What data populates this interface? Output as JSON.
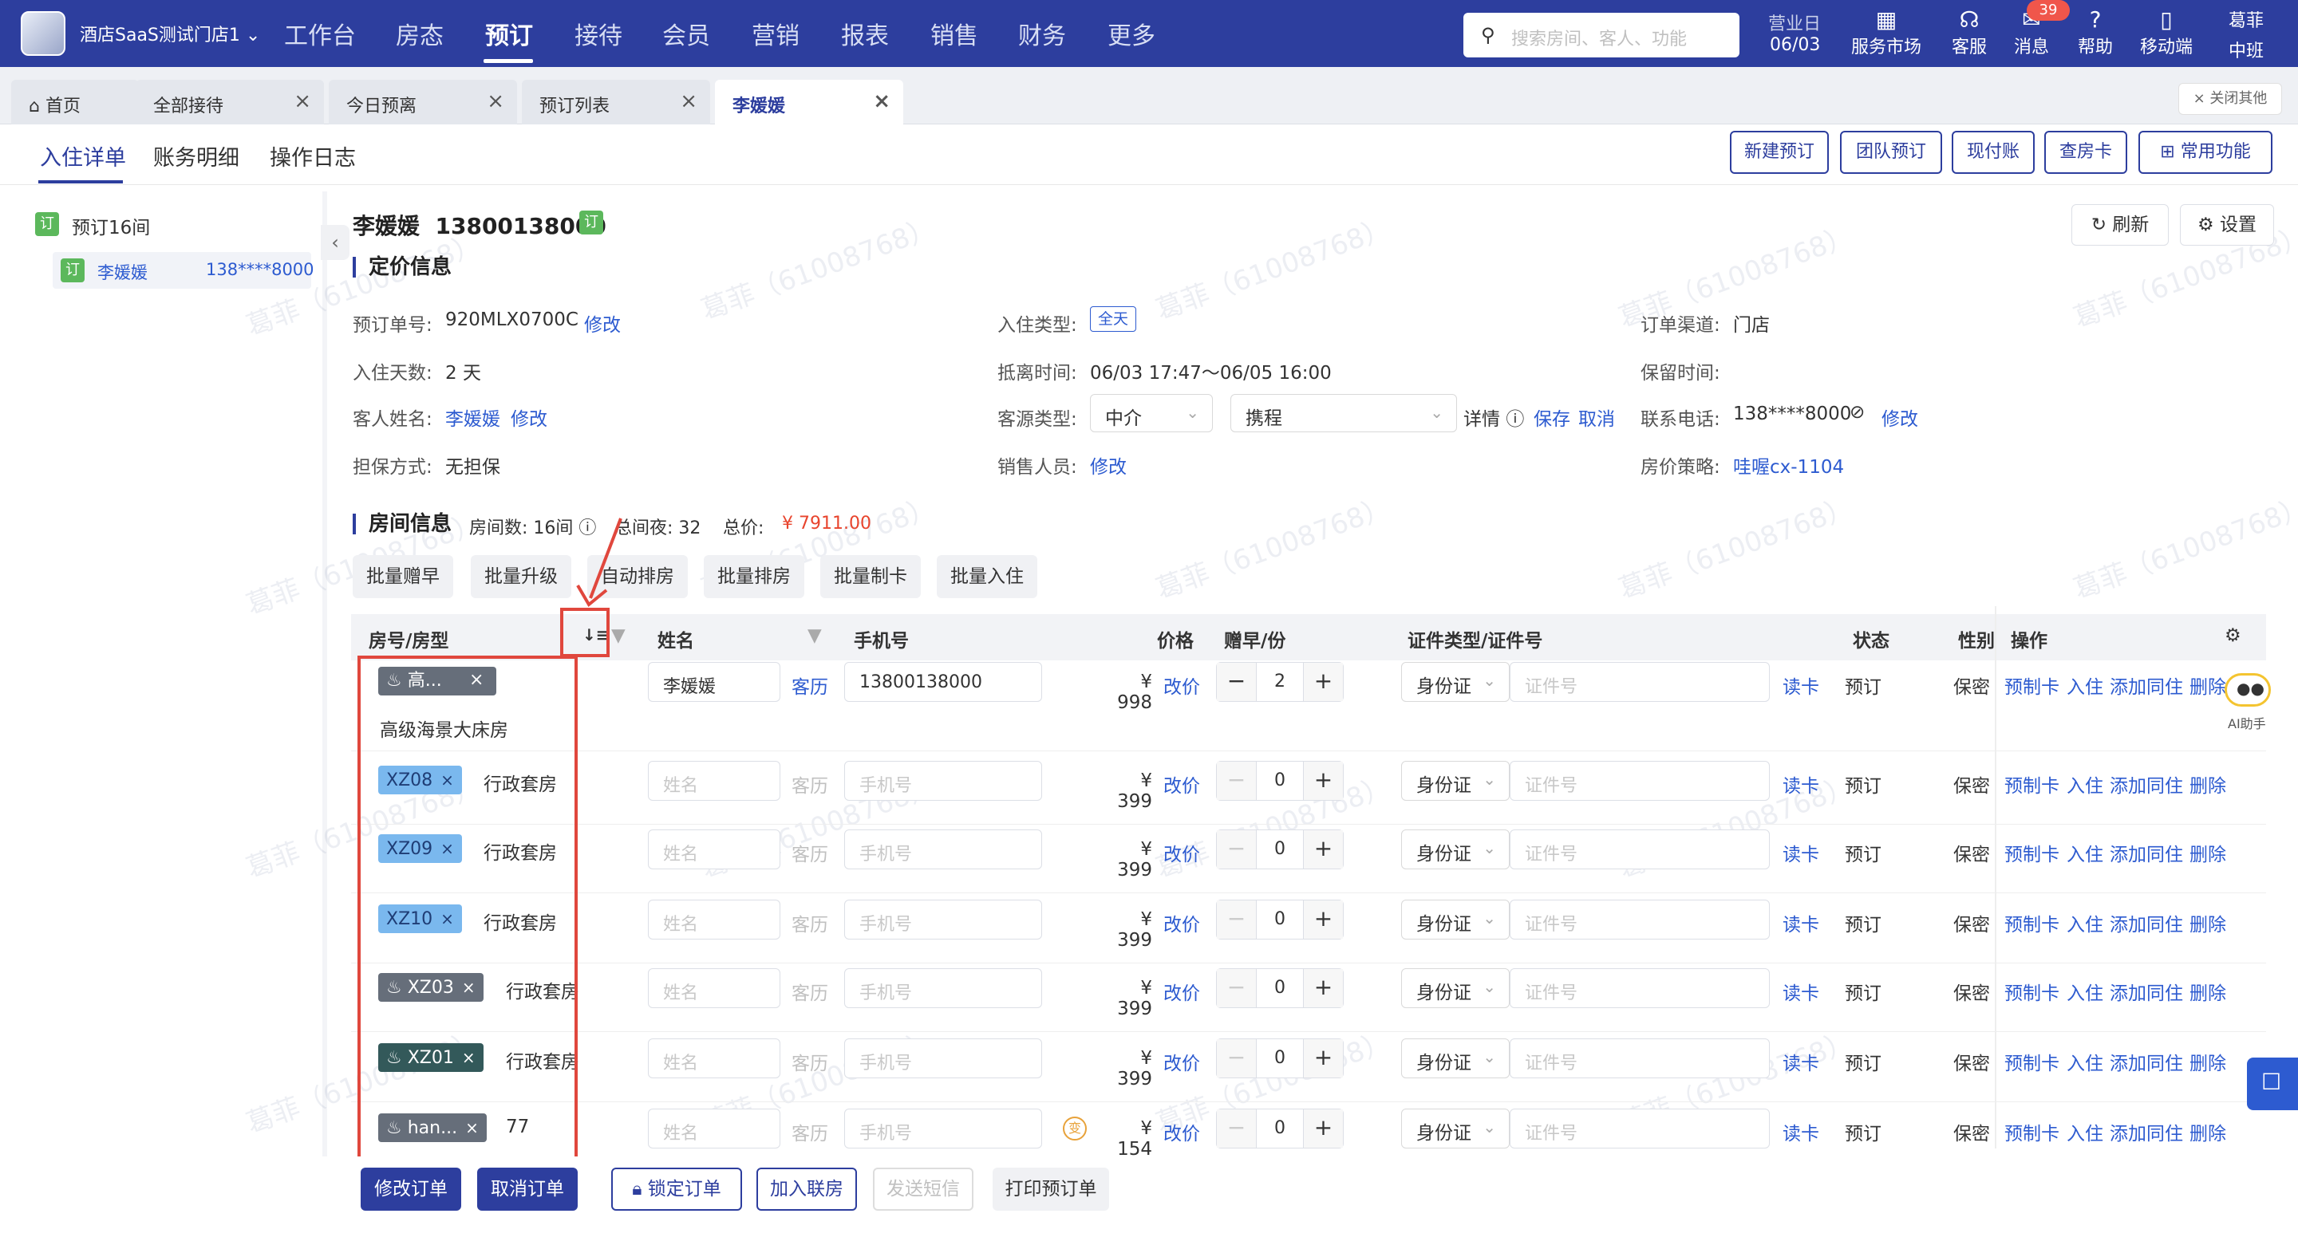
{
  "topbar": {
    "hotel_name": "酒店SaaS测试门店1",
    "nav": [
      "工作台",
      "房态",
      "预订",
      "接待",
      "会员",
      "营销",
      "报表",
      "销售",
      "财务",
      "更多"
    ],
    "active_nav": "预订",
    "search_placeholder": "搜索房间、客人、功能",
    "business_day_label": "营业日",
    "business_day_value": "06/03",
    "service_market": "服务市场",
    "customer_service": "客服",
    "messages": "消息",
    "message_count": "39",
    "help": "帮助",
    "mobile": "移动端",
    "user_name": "葛菲",
    "user_status": "中班"
  },
  "tabs": {
    "items": [
      "首页",
      "全部接待",
      "今日预离",
      "预订列表",
      "李媛媛"
    ],
    "close_others": "× 关闭其他"
  },
  "subtabs": [
    "入住详单",
    "账务明细",
    "操作日志"
  ],
  "actions": [
    "新建预订",
    "团队预订",
    "现付账",
    "查房卡",
    "常用功能"
  ],
  "left_panel": {
    "badge": "订",
    "summary": "预订16间",
    "guest_name": "李媛媛",
    "guest_phone": "138****8000"
  },
  "header": {
    "name_phone": "李媛媛  13800138000",
    "badge": "订",
    "refresh": "刷新",
    "settings": "设置"
  },
  "pricing": {
    "title": "定价信息",
    "order_no_label": "预订单号:",
    "order_no": "920MLX0700C",
    "edit": "修改",
    "nights_label": "入住天数:",
    "nights": "2 天",
    "guest_label": "客人姓名:",
    "guest": "李媛媛",
    "guarantee_label": "担保方式:",
    "guarantee": "无担保",
    "stay_type_label": "入住类型:",
    "stay_type": "全天",
    "arrive_leave_label": "抵离时间:",
    "arrive_leave": "06/03 17:47～06/05 16:00",
    "source_label": "客源类型:",
    "source_type": "中介",
    "source_channel": "携程",
    "detail": "详情",
    "save": "保存",
    "cancel": "取消",
    "sales_label": "销售人员:",
    "channel_label": "订单渠道:",
    "channel": "门店",
    "hold_label": "保留时间:",
    "phone_label": "联系电话:",
    "phone": "138****8000",
    "policy_label": "房价策略:",
    "policy": "哇喔cx-1104"
  },
  "rooms": {
    "title": "房间信息",
    "count_label": "房间数:",
    "count": "16间",
    "nights_label": "总间夜:",
    "nights": "32",
    "total_label": "总价:",
    "total": "¥ 7911.00",
    "batch_buttons": [
      "批量赠早",
      "批量升级",
      "自动排房",
      "批量排房",
      "批量制卡",
      "批量入住"
    ]
  },
  "table": {
    "headers": {
      "room": "房号/房型",
      "name": "姓名",
      "phone": "手机号",
      "price": "价格",
      "breakfast": "赠早/份",
      "cert": "证件类型/证件号",
      "status": "状态",
      "gender": "性别",
      "ops": "操作"
    },
    "name_placeholder": "姓名",
    "phone_placeholder": "手机号",
    "cert_placeholder": "证件号",
    "history": "客历",
    "change_price": "改价",
    "read_card": "读卡",
    "gender_value": "保密",
    "op_labels": [
      "预制卡",
      "入住",
      "添加同住",
      "删除"
    ],
    "rows": [
      {
        "tag": "高...",
        "room_type": "高级海景大床房",
        "name": "李媛媛",
        "phone": "13800138000",
        "price": "¥ 998",
        "breakfast": "2",
        "cert_type": "身份证",
        "status": "预订"
      },
      {
        "tag": "XZ08",
        "room_type": "行政套房",
        "name": "",
        "phone": "",
        "price": "¥ 399",
        "breakfast": "0",
        "cert_type": "身份证",
        "status": "预订"
      },
      {
        "tag": "XZ09",
        "room_type": "行政套房",
        "name": "",
        "phone": "",
        "price": "¥ 399",
        "breakfast": "0",
        "cert_type": "身份证",
        "status": "预订"
      },
      {
        "tag": "XZ10",
        "room_type": "行政套房",
        "name": "",
        "phone": "",
        "price": "¥ 399",
        "breakfast": "0",
        "cert_type": "身份证",
        "status": "预订"
      },
      {
        "tag": "XZ03",
        "room_type": "行政套房",
        "name": "",
        "phone": "",
        "price": "¥ 399",
        "breakfast": "0",
        "cert_type": "身份证",
        "status": "预订"
      },
      {
        "tag": "XZ01",
        "room_type": "行政套房",
        "name": "",
        "phone": "",
        "price": "¥ 399",
        "breakfast": "0",
        "cert_type": "身份证",
        "status": "预订"
      },
      {
        "tag": "han...",
        "room_type": "77",
        "name": "",
        "phone": "",
        "price": "¥ 154",
        "price_badge": "变",
        "breakfast": "0",
        "cert_type": "身份证",
        "status": "预订"
      }
    ]
  },
  "bottom": {
    "buttons": [
      "修改订单",
      "取消订单",
      "锁定订单",
      "加入联房",
      "发送短信",
      "打印预订单"
    ]
  },
  "watermark": "葛菲（61008768）",
  "ai_assistant": "AI助手",
  "colors": {
    "brand": "#2d3e9e",
    "link": "#2d5bd0",
    "price_red": "#e8442d",
    "annotation_red": "#e0473d",
    "tag_green": "#5cb85c"
  }
}
